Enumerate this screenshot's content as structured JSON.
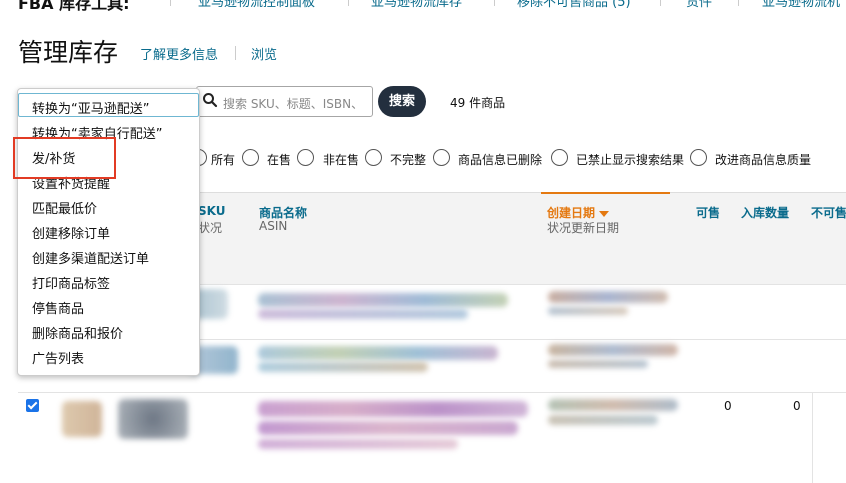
{
  "nav": {
    "brand": "FBA 库存工具:",
    "items": [
      "亚马逊物流控制面板",
      "亚马逊物流库存",
      "移除不可售商品 (5)",
      "货件",
      "亚马逊物流机"
    ]
  },
  "header": {
    "title": "管理库存",
    "learn_more": "了解更多信息",
    "browse": "浏览"
  },
  "search": {
    "placeholder": "搜索 SKU、标题、ISBN、",
    "button": "搜索",
    "count": "49 件商品"
  },
  "filters": [
    "所有",
    "在售",
    "非在售",
    "不完整",
    "商品信息已删除",
    "已禁止显示搜索结果",
    "改进商品信息质量"
  ],
  "table": {
    "sku_header": "SKU",
    "sku_sub": "状况",
    "name_header": "商品名称",
    "name_sub": "ASIN",
    "date_header": "创建日期",
    "date_sub": "状况更新日期",
    "available_header": "可售",
    "inbound_header": "入库数量",
    "unfulfillable_header": "不可售",
    "row3": {
      "available": "0",
      "inbound": "0"
    }
  },
  "dropdown": {
    "items": [
      "转换为“亚马逊配送”",
      "转换为“卖家自行配送”",
      "发/补货",
      "设置补货提醒",
      "匹配最低价",
      "创建移除订单",
      "创建多渠道配送订单",
      "打印商品标签",
      "停售商品",
      "删除商品和报价",
      "广告列表"
    ]
  },
  "colors": {
    "link": "#0a6b8c",
    "active_sort": "#e47911",
    "highlight_box": "#e23b24",
    "search_button": "#232f3e"
  }
}
